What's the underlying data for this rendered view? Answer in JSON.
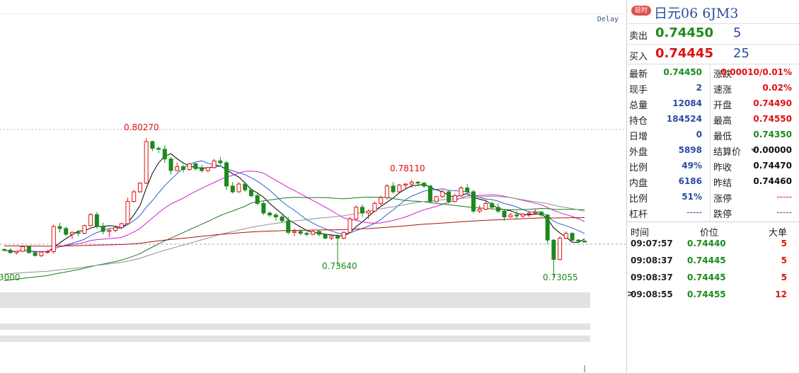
{
  "chart": {
    "delay_label": "Delay",
    "annotations": {
      "high_1": "0.80270",
      "high_2": "0.78110",
      "low_1": "0.73640",
      "low_2": "0.73055",
      "left_edge": "3000"
    }
  },
  "chart_data": {
    "type": "candlestick",
    "candles": [
      [
        0.7452,
        0.7455,
        0.744,
        0.7448
      ],
      [
        0.7448,
        0.7458,
        0.743,
        0.7435
      ],
      [
        0.7435,
        0.7445,
        0.7425,
        0.7442
      ],
      [
        0.7442,
        0.747,
        0.7438,
        0.7466
      ],
      [
        0.7466,
        0.747,
        0.743,
        0.7435
      ],
      [
        0.7435,
        0.7445,
        0.7415,
        0.742
      ],
      [
        0.742,
        0.744,
        0.7412,
        0.7438
      ],
      [
        0.7438,
        0.745,
        0.743,
        0.744
      ],
      [
        0.744,
        0.758,
        0.743,
        0.757
      ],
      [
        0.757,
        0.759,
        0.754,
        0.756
      ],
      [
        0.756,
        0.757,
        0.752,
        0.753
      ],
      [
        0.753,
        0.7545,
        0.7505,
        0.754
      ],
      [
        0.754,
        0.755,
        0.752,
        0.7535
      ],
      [
        0.7535,
        0.758,
        0.753,
        0.7575
      ],
      [
        0.7575,
        0.764,
        0.757,
        0.7632
      ],
      [
        0.7632,
        0.7645,
        0.756,
        0.757
      ],
      [
        0.757,
        0.759,
        0.753,
        0.7545
      ],
      [
        0.7545,
        0.756,
        0.7515,
        0.755
      ],
      [
        0.755,
        0.757,
        0.754,
        0.7565
      ],
      [
        0.7565,
        0.759,
        0.7555,
        0.7585
      ],
      [
        0.7585,
        0.772,
        0.758,
        0.77
      ],
      [
        0.77,
        0.776,
        0.7695,
        0.775
      ],
      [
        0.775,
        0.78,
        0.7745,
        0.7795
      ],
      [
        0.7795,
        0.8027,
        0.779,
        0.801
      ],
      [
        0.801,
        0.8015,
        0.796,
        0.7975
      ],
      [
        0.7975,
        0.7985,
        0.795,
        0.797
      ],
      [
        0.797,
        0.799,
        0.79,
        0.792
      ],
      [
        0.792,
        0.793,
        0.784,
        0.786
      ],
      [
        0.786,
        0.79,
        0.7855,
        0.788
      ],
      [
        0.788,
        0.789,
        0.785,
        0.7865
      ],
      [
        0.7865,
        0.79,
        0.786,
        0.7895
      ],
      [
        0.7895,
        0.79,
        0.786,
        0.787
      ],
      [
        0.787,
        0.789,
        0.785,
        0.786
      ],
      [
        0.786,
        0.788,
        0.785,
        0.7875
      ],
      [
        0.7875,
        0.792,
        0.787,
        0.791
      ],
      [
        0.791,
        0.793,
        0.788,
        0.79
      ],
      [
        0.79,
        0.791,
        0.776,
        0.778
      ],
      [
        0.778,
        0.78,
        0.774,
        0.775
      ],
      [
        0.775,
        0.78,
        0.7745,
        0.779
      ],
      [
        0.779,
        0.7795,
        0.775,
        0.776
      ],
      [
        0.776,
        0.777,
        0.772,
        0.773
      ],
      [
        0.773,
        0.774,
        0.768,
        0.769
      ],
      [
        0.769,
        0.77,
        0.763,
        0.764
      ],
      [
        0.764,
        0.765,
        0.762,
        0.763
      ],
      [
        0.763,
        0.764,
        0.76,
        0.762
      ],
      [
        0.762,
        0.763,
        0.759,
        0.76
      ],
      [
        0.76,
        0.762,
        0.753,
        0.754
      ],
      [
        0.754,
        0.756,
        0.752,
        0.7545
      ],
      [
        0.7545,
        0.7555,
        0.7525,
        0.7535
      ],
      [
        0.7535,
        0.7545,
        0.752,
        0.753
      ],
      [
        0.753,
        0.755,
        0.7525,
        0.7545
      ],
      [
        0.7545,
        0.755,
        0.752,
        0.753
      ],
      [
        0.753,
        0.7535,
        0.7505,
        0.751
      ],
      [
        0.751,
        0.7525,
        0.75,
        0.752
      ],
      [
        0.752,
        0.753,
        0.7364,
        0.751
      ],
      [
        0.751,
        0.7545,
        0.7505,
        0.754
      ],
      [
        0.754,
        0.762,
        0.7535,
        0.761
      ],
      [
        0.761,
        0.768,
        0.76,
        0.767
      ],
      [
        0.767,
        0.7685,
        0.762,
        0.764
      ],
      [
        0.764,
        0.766,
        0.761,
        0.765
      ],
      [
        0.765,
        0.77,
        0.7645,
        0.769
      ],
      [
        0.769,
        0.773,
        0.768,
        0.772
      ],
      [
        0.772,
        0.779,
        0.771,
        0.778
      ],
      [
        0.778,
        0.78,
        0.774,
        0.775
      ],
      [
        0.775,
        0.779,
        0.7745,
        0.7785
      ],
      [
        0.7785,
        0.7795,
        0.776,
        0.779
      ],
      [
        0.779,
        0.7811,
        0.777,
        0.78
      ],
      [
        0.78,
        0.7805,
        0.778,
        0.7795
      ],
      [
        0.7795,
        0.78,
        0.777,
        0.778
      ],
      [
        0.778,
        0.7785,
        0.769,
        0.77
      ],
      [
        0.77,
        0.773,
        0.7695,
        0.7725
      ],
      [
        0.7725,
        0.776,
        0.772,
        0.775
      ],
      [
        0.775,
        0.776,
        0.769,
        0.77
      ],
      [
        0.77,
        0.774,
        0.7695,
        0.773
      ],
      [
        0.773,
        0.778,
        0.7725,
        0.777
      ],
      [
        0.777,
        0.779,
        0.774,
        0.775
      ],
      [
        0.775,
        0.776,
        0.764,
        0.765
      ],
      [
        0.765,
        0.768,
        0.764,
        0.766
      ],
      [
        0.766,
        0.77,
        0.7655,
        0.769
      ],
      [
        0.769,
        0.77,
        0.766,
        0.767
      ],
      [
        0.767,
        0.769,
        0.764,
        0.765
      ],
      [
        0.765,
        0.766,
        0.76,
        0.762
      ],
      [
        0.762,
        0.764,
        0.7615,
        0.763
      ],
      [
        0.763,
        0.765,
        0.761,
        0.7625
      ],
      [
        0.7625,
        0.764,
        0.7615,
        0.7635
      ],
      [
        0.7635,
        0.765,
        0.762,
        0.764
      ],
      [
        0.764,
        0.766,
        0.763,
        0.7645
      ],
      [
        0.7645,
        0.765,
        0.762,
        0.763
      ],
      [
        0.763,
        0.7635,
        0.748,
        0.75
      ],
      [
        0.75,
        0.7505,
        0.73055,
        0.74
      ],
      [
        0.74,
        0.752,
        0.7395,
        0.751
      ],
      [
        0.751,
        0.7545,
        0.7505,
        0.7535
      ],
      [
        0.7535,
        0.754,
        0.749,
        0.75
      ],
      [
        0.75,
        0.7505,
        0.7485,
        0.7495
      ],
      [
        0.7495,
        0.75,
        0.7488,
        0.749
      ]
    ],
    "ylim": [
      0.727,
      0.812
    ]
  },
  "panel": {
    "badge": "延时",
    "title": "日元06  6JM3",
    "sell": {
      "label": "卖出",
      "price": "0.74450",
      "vol": "5"
    },
    "buy": {
      "label": "买入",
      "price": "0.74445",
      "vol": "25"
    },
    "stats_left": [
      {
        "label": "最新",
        "value": "0.74450"
      },
      {
        "label": "现手",
        "value": "2"
      },
      {
        "label": "总量",
        "value": "12084"
      },
      {
        "label": "持仓",
        "value": "184524"
      },
      {
        "label": "日增",
        "value": "0"
      },
      {
        "label": "外盘",
        "value": "5898"
      },
      {
        "label": "比例",
        "value": "49%"
      },
      {
        "label": "内盘",
        "value": "6186"
      },
      {
        "label": "比例",
        "value": "51%"
      },
      {
        "label": "杠杆",
        "value": "-----"
      }
    ],
    "stats_right": [
      {
        "label": "涨跌",
        "value": "0.00010/0.01%"
      },
      {
        "label": "速涨",
        "value": "0.02%"
      },
      {
        "label": "开盘",
        "value": "0.74490"
      },
      {
        "label": "最高",
        "value": "0.74550"
      },
      {
        "label": "最低",
        "value": "0.74350"
      },
      {
        "label": "结算价",
        "value": "0.00000"
      },
      {
        "label": "昨收",
        "value": "0.74470"
      },
      {
        "label": "昨结",
        "value": "0.74460"
      },
      {
        "label": "涨停",
        "value": "-----"
      },
      {
        "label": "跌停",
        "value": "-----"
      }
    ],
    "trades_header": {
      "time": "时间",
      "price": "价位",
      "vol": "大单"
    },
    "trades": [
      {
        "time": "09:07:57",
        "price": "0.74440",
        "vol": "5"
      },
      {
        "time": "09:08:37",
        "price": "0.74445",
        "vol": "5"
      },
      {
        "time": "09:08:37",
        "price": "0.74445",
        "vol": "5"
      },
      {
        "time": "09:08:55",
        "price": "0.74455",
        "vol": "12"
      }
    ]
  },
  "colors": {
    "up": "#e01010",
    "down": "#1a8a1a",
    "ma5": "#000000",
    "ma10": "#2a5fd0",
    "ma20": "#d020d0",
    "ma40": "#1a7a1a",
    "ma60": "#909090",
    "ma120": "#b01010"
  }
}
